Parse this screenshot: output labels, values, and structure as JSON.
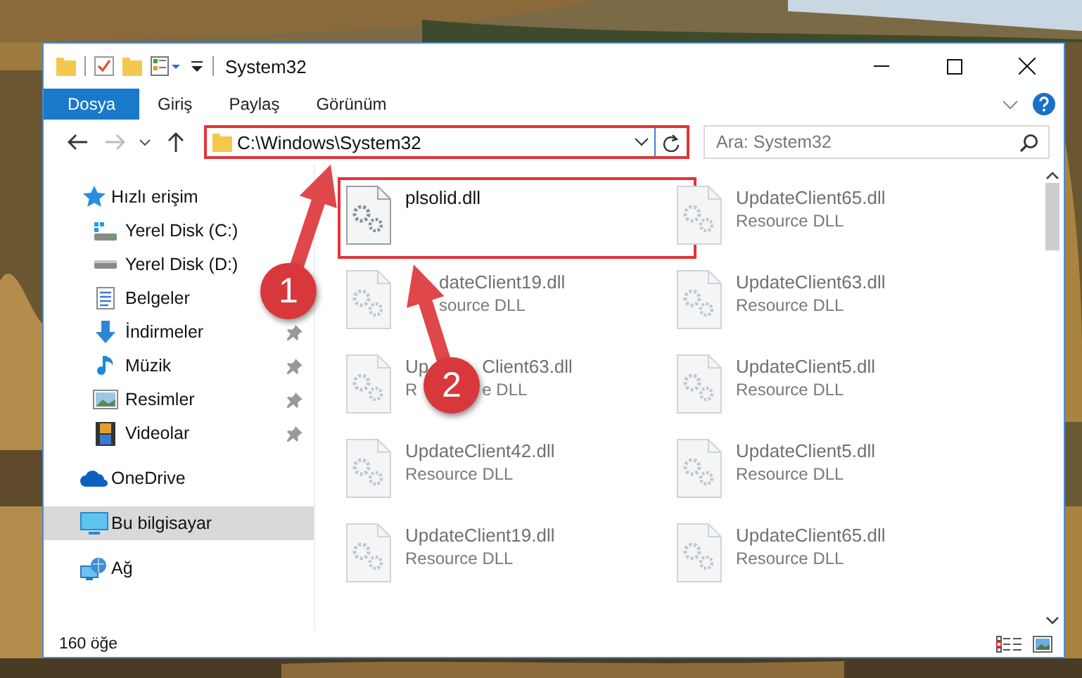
{
  "window": {
    "title": "System32"
  },
  "ribbon": {
    "tabs": [
      {
        "label": "Dosya",
        "selected": true
      },
      {
        "label": "Giriş",
        "selected": false
      },
      {
        "label": "Paylaş",
        "selected": false
      },
      {
        "label": "Görünüm",
        "selected": false
      }
    ]
  },
  "address": {
    "path": "C:\\Windows\\System32",
    "highlighted": true
  },
  "search": {
    "placeholder": "Ara: System32"
  },
  "sidebar": {
    "items": [
      {
        "label": "Hızlı erişim",
        "kind": "quick",
        "selected": false,
        "children": [
          {
            "label": "Yerel Disk (C:)",
            "kind": "system-drive",
            "selected": false
          },
          {
            "label": "Yerel Disk (D:)",
            "kind": "drive",
            "selected": false
          },
          {
            "label": "Belgeler",
            "kind": "documents",
            "selected": false
          },
          {
            "label": "İndirmeler",
            "kind": "downloads",
            "pinned": true,
            "selected": false
          },
          {
            "label": "Müzik",
            "kind": "music",
            "pinned": true,
            "selected": false
          },
          {
            "label": "Resimler",
            "kind": "pictures",
            "pinned": true,
            "selected": false
          },
          {
            "label": "Videolar",
            "kind": "videos",
            "pinned": true,
            "selected": false
          }
        ]
      },
      {
        "label": "OneDrive",
        "kind": "cloud",
        "selected": false
      },
      {
        "label": "Bu bilgisayar",
        "kind": "pc",
        "selected": true
      },
      {
        "label": "Ağ",
        "kind": "network",
        "selected": false
      }
    ]
  },
  "files": [
    {
      "name": "plsolid.dll",
      "blurred": false,
      "highlighted": true
    },
    {
      "name": "UpdateClient65.dll",
      "type": "Resource DLL",
      "blurred": true,
      "highlighted": false
    },
    {
      "name": "dateClient19.dll",
      "type": "source DLL",
      "blurred": true,
      "highlighted": false
    },
    {
      "name": "UpdateClient63.dll",
      "type": "Resource DLL",
      "blurred": true,
      "highlighted": false
    },
    {
      "name": [
        "Up",
        "Client63.dll"
      ],
      "type": [
        "R",
        "e DLL"
      ],
      "blurred": true,
      "highlighted": false
    },
    {
      "name": "UpdateClient5.dll",
      "type": "Resource DLL",
      "blurred": true,
      "highlighted": false
    },
    {
      "name": "UpdateClient42.dll",
      "type": "Resource DLL",
      "blurred": true,
      "highlighted": false
    },
    {
      "name": "UpdateClient5.dll",
      "type": "Resource DLL",
      "blurred": true,
      "highlighted": false
    },
    {
      "name": "UpdateClient19.dll",
      "type": "Resource DLL",
      "blurred": true,
      "highlighted": false
    },
    {
      "name": "UpdateClient65.dll",
      "type": "Resource DLL",
      "blurred": true,
      "highlighted": false
    }
  ],
  "status_bar": {
    "count": "160 öğe"
  },
  "annotations": [
    {
      "label": "1"
    },
    {
      "label": "2"
    }
  ]
}
